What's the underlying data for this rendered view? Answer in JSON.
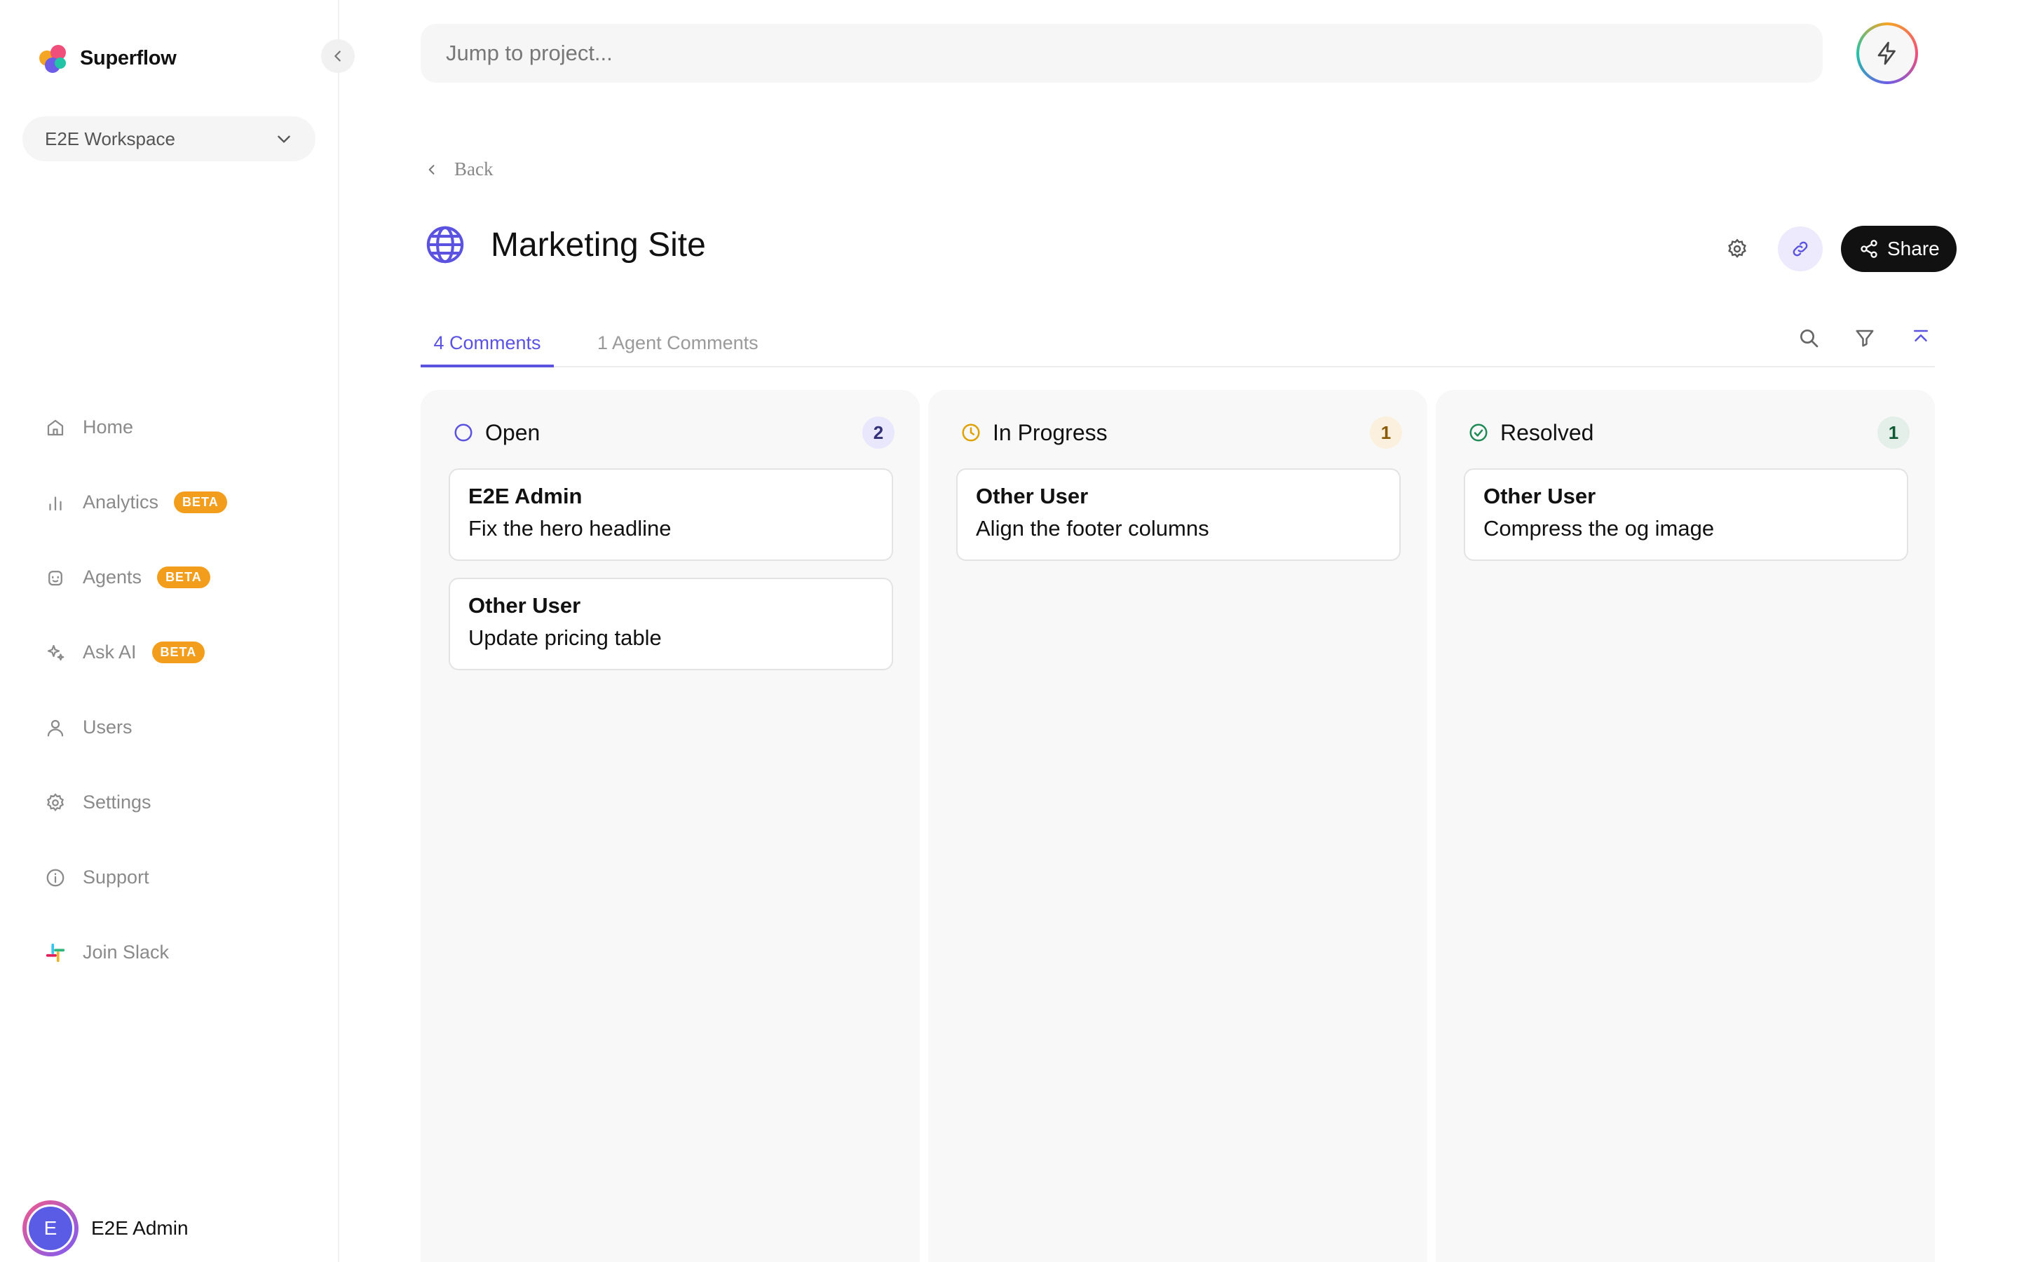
{
  "app": {
    "name": "Superflow"
  },
  "sidebar": {
    "workspace": "E2E Workspace",
    "items": [
      {
        "label": "Home",
        "icon": "home-icon",
        "badge": ""
      },
      {
        "label": "Analytics",
        "icon": "bar-chart-icon",
        "badge": "BETA"
      },
      {
        "label": "Agents",
        "icon": "robot-icon",
        "badge": "BETA"
      },
      {
        "label": "Ask AI",
        "icon": "sparkle-icon",
        "badge": "BETA"
      },
      {
        "label": "Users",
        "icon": "user-icon",
        "badge": ""
      },
      {
        "label": "Settings",
        "icon": "gear-icon",
        "badge": ""
      },
      {
        "label": "Support",
        "icon": "info-icon",
        "badge": ""
      },
      {
        "label": "Join Slack",
        "icon": "slack-icon",
        "badge": ""
      }
    ],
    "user": {
      "initial": "E",
      "name": "E2E Admin"
    }
  },
  "header": {
    "search_placeholder": "Jump to project..."
  },
  "page": {
    "back_label": "Back",
    "title": "Marketing Site",
    "share_label": "Share"
  },
  "tabs": [
    {
      "label": "4 Comments",
      "active": true
    },
    {
      "label": "1 Agent Comments",
      "active": false
    }
  ],
  "columns": [
    {
      "title": "Open",
      "count": "2",
      "status_color": "#5b53e0",
      "cards": [
        {
          "author": "E2E Admin",
          "text": "Fix the hero headline"
        },
        {
          "author": "Other User",
          "text": "Update pricing table"
        }
      ]
    },
    {
      "title": "In Progress",
      "count": "1",
      "status_color": "#e0a100",
      "cards": [
        {
          "author": "Other User",
          "text": "Align the footer columns"
        }
      ]
    },
    {
      "title": "Resolved",
      "count": "1",
      "status_color": "#1f8a55",
      "cards": [
        {
          "author": "Other User",
          "text": "Compress the og image"
        }
      ]
    }
  ],
  "colors": {
    "accent": "#5b53e0",
    "beta": "#f29d1c",
    "dark": "#111111"
  }
}
